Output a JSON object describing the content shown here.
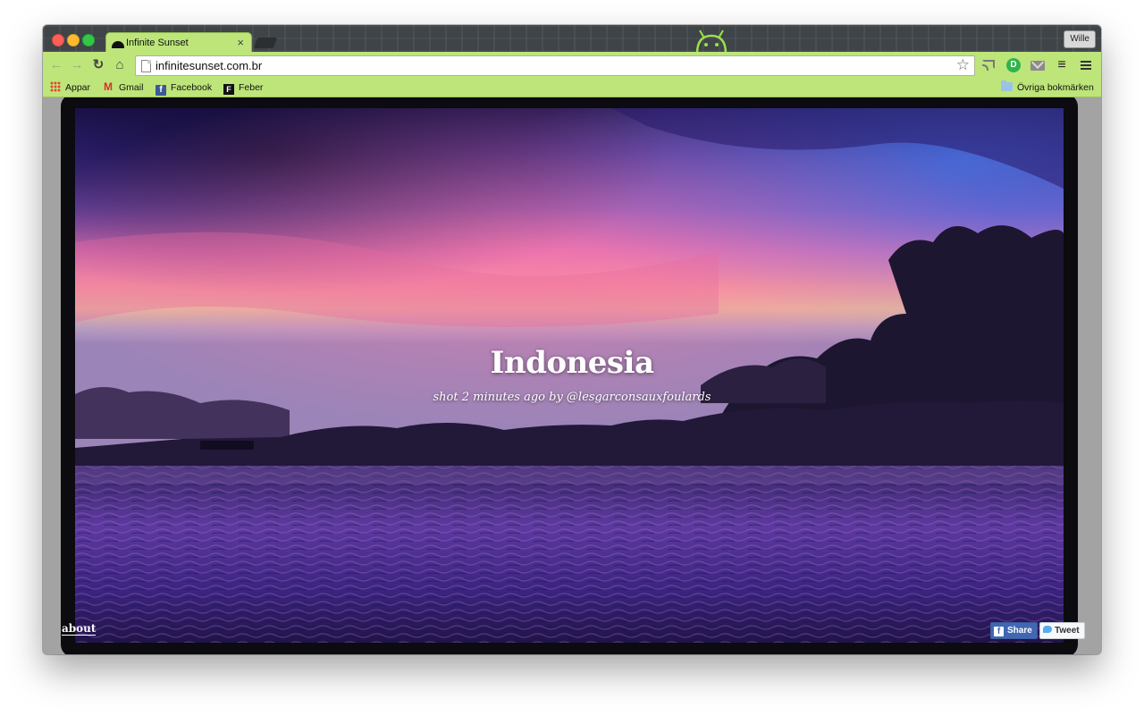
{
  "browser": {
    "tab": {
      "title": "Infinite Sunset",
      "close_glyph": "×"
    },
    "profile_name": "Wille",
    "address": "infinitesunset.com.br",
    "bookmarks": [
      {
        "label": "Appar",
        "icon": "apps-grid-icon"
      },
      {
        "label": "Gmail",
        "icon": "gmail-icon"
      },
      {
        "label": "Facebook",
        "icon": "facebook-icon"
      },
      {
        "label": "Feber",
        "icon": "feber-icon"
      }
    ],
    "other_bookmarks": "Övriga bokmärken"
  },
  "page": {
    "title": "Indonesia",
    "credit": "shot 2 minutes ago by @lesgarconsauxfoulards",
    "about_link": "about",
    "share_label": "Share",
    "tweet_label": "Tweet"
  },
  "colors": {
    "browser_theme": "#bde57a",
    "facebook": "#4267b2",
    "twitter": "#55acee"
  }
}
